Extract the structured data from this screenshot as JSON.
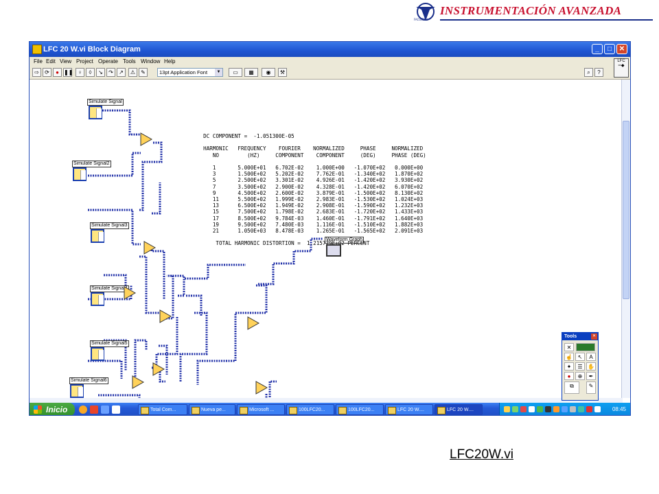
{
  "header": {
    "brand": "INSTRUMENTACIÓN AVANZADA"
  },
  "window": {
    "title": "LFC 20 W.vi Block Diagram",
    "menu": [
      "File",
      "Edit",
      "View",
      "Project",
      "Operate",
      "Tools",
      "Window",
      "Help"
    ],
    "font_select": "13pt Application Font",
    "context_help_label": "LFC"
  },
  "diagram": {
    "signals": [
      "Simulate Signal",
      "Simulate Signal2",
      "Simulate Signal3",
      "Simulate Signal4",
      "Simulate Signal5",
      "Simulate Signal6"
    ],
    "graph_label": "Waveform Graph"
  },
  "report": {
    "dc_line": "DC COMPONENT =  -1.051300E-05",
    "headers": [
      "HARMONIC",
      "FREQUENCY",
      "FOURIER",
      "NORMALIZED",
      "PHASE",
      "NORMALIZED"
    ],
    "subheaders": [
      "NO",
      "(HZ)",
      "COMPONENT",
      "COMPONENT",
      "(DEG)",
      "PHASE (DEG)"
    ],
    "rows": [
      [
        "1",
        "5.000E+01",
        "6.702E-02",
        "1.000E+00",
        "-1.070E+02",
        "0.000E+00"
      ],
      [
        "3",
        "1.500E+02",
        "5.202E-02",
        "7.762E-01",
        "-1.340E+02",
        "1.870E+02"
      ],
      [
        "5",
        "2.500E+02",
        "3.301E-02",
        "4.926E-01",
        "-1.420E+02",
        "3.930E+02"
      ],
      [
        "7",
        "3.500E+02",
        "2.900E-02",
        "4.328E-01",
        "-1.420E+02",
        "6.070E+02"
      ],
      [
        "9",
        "4.500E+02",
        "2.600E-02",
        "3.879E-01",
        "-1.500E+02",
        "8.130E+02"
      ],
      [
        "11",
        "5.500E+02",
        "1.999E-02",
        "2.983E-01",
        "-1.530E+02",
        "1.024E+03"
      ],
      [
        "13",
        "6.500E+02",
        "1.949E-02",
        "2.908E-01",
        "-1.590E+02",
        "1.232E+03"
      ],
      [
        "15",
        "7.500E+02",
        "1.798E-02",
        "2.683E-01",
        "-1.720E+02",
        "1.433E+03"
      ],
      [
        "17",
        "8.500E+02",
        "9.784E-03",
        "1.460E-01",
        "-1.791E+02",
        "1.640E+03"
      ],
      [
        "19",
        "9.500E+02",
        "7.480E-03",
        "1.116E-01",
        "-1.510E+02",
        "1.882E+03"
      ],
      [
        "21",
        "1.050E+03",
        "8.478E-03",
        "1.265E-01",
        "-1.565E+02",
        "2.091E+03"
      ]
    ],
    "thd_line": "TOTAL HARMONIC DISTORTION =  1.215779E+02 PERCENT"
  },
  "taskbar": {
    "start": "Inicio",
    "tasks": [
      "Total Com...",
      "Nueva pe...",
      "Microsoft ...",
      "100LFC20...",
      "100LFC20...",
      "LFC 20 W....",
      "LFC 20 W...."
    ],
    "clock": "08:45"
  },
  "tools_palette": {
    "title": "Tools"
  },
  "footer": {
    "caption": "LFC20W.vi"
  }
}
